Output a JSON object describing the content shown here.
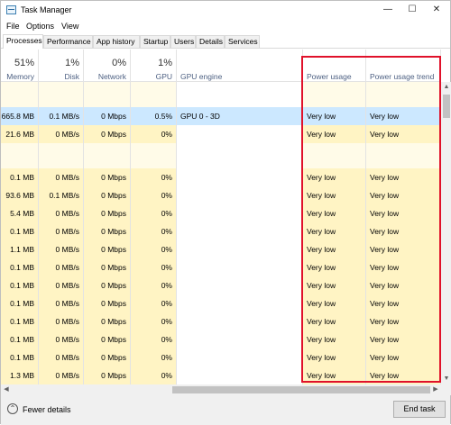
{
  "window": {
    "title": "Task Manager",
    "app_icon": "task-manager-icon"
  },
  "window_controls": {
    "minimize": "—",
    "maximize": "☐",
    "close": "✕"
  },
  "menu": [
    "File",
    "Options",
    "View"
  ],
  "tabs": [
    {
      "label": "Processes",
      "active": true
    },
    {
      "label": "Performance",
      "active": false
    },
    {
      "label": "App history",
      "active": false
    },
    {
      "label": "Startup",
      "active": false
    },
    {
      "label": "Users",
      "active": false
    },
    {
      "label": "Details",
      "active": false
    },
    {
      "label": "Services",
      "active": false
    }
  ],
  "columns": [
    {
      "label": "Memory",
      "percent": "51%"
    },
    {
      "label": "Disk",
      "percent": "1%"
    },
    {
      "label": "Network",
      "percent": "0%"
    },
    {
      "label": "GPU",
      "percent": "1%"
    },
    {
      "label": "GPU engine",
      "percent": ""
    },
    {
      "label": "Power usage",
      "percent": ""
    },
    {
      "label": "Power usage trend",
      "percent": ""
    }
  ],
  "rows": [
    {
      "memory": "",
      "disk": "",
      "network": "",
      "gpu": "",
      "gpu_engine": "",
      "power": "",
      "trend": "",
      "group": true
    },
    {
      "memory": "665.8 MB",
      "disk": "0.1 MB/s",
      "network": "0 Mbps",
      "gpu": "0.5%",
      "gpu_engine": "GPU 0 - 3D",
      "power": "Very low",
      "trend": "Very low",
      "selected": true
    },
    {
      "memory": "21.6 MB",
      "disk": "0 MB/s",
      "network": "0 Mbps",
      "gpu": "0%",
      "gpu_engine": "",
      "power": "Very low",
      "trend": "Very low"
    },
    {
      "memory": "",
      "disk": "",
      "network": "",
      "gpu": "",
      "gpu_engine": "",
      "power": "",
      "trend": "",
      "group": true
    },
    {
      "memory": "0.1 MB",
      "disk": "0 MB/s",
      "network": "0 Mbps",
      "gpu": "0%",
      "gpu_engine": "",
      "power": "Very low",
      "trend": "Very low"
    },
    {
      "memory": "93.6 MB",
      "disk": "0.1 MB/s",
      "network": "0 Mbps",
      "gpu": "0%",
      "gpu_engine": "",
      "power": "Very low",
      "trend": "Very low"
    },
    {
      "memory": "5.4 MB",
      "disk": "0 MB/s",
      "network": "0 Mbps",
      "gpu": "0%",
      "gpu_engine": "",
      "power": "Very low",
      "trend": "Very low"
    },
    {
      "memory": "0.1 MB",
      "disk": "0 MB/s",
      "network": "0 Mbps",
      "gpu": "0%",
      "gpu_engine": "",
      "power": "Very low",
      "trend": "Very low"
    },
    {
      "memory": "1.1 MB",
      "disk": "0 MB/s",
      "network": "0 Mbps",
      "gpu": "0%",
      "gpu_engine": "",
      "power": "Very low",
      "trend": "Very low"
    },
    {
      "memory": "0.1 MB",
      "disk": "0 MB/s",
      "network": "0 Mbps",
      "gpu": "0%",
      "gpu_engine": "",
      "power": "Very low",
      "trend": "Very low"
    },
    {
      "memory": "0.1 MB",
      "disk": "0 MB/s",
      "network": "0 Mbps",
      "gpu": "0%",
      "gpu_engine": "",
      "power": "Very low",
      "trend": "Very low"
    },
    {
      "memory": "0.1 MB",
      "disk": "0 MB/s",
      "network": "0 Mbps",
      "gpu": "0%",
      "gpu_engine": "",
      "power": "Very low",
      "trend": "Very low"
    },
    {
      "memory": "0.1 MB",
      "disk": "0 MB/s",
      "network": "0 Mbps",
      "gpu": "0%",
      "gpu_engine": "",
      "power": "Very low",
      "trend": "Very low"
    },
    {
      "memory": "0.1 MB",
      "disk": "0 MB/s",
      "network": "0 Mbps",
      "gpu": "0%",
      "gpu_engine": "",
      "power": "Very low",
      "trend": "Very low"
    },
    {
      "memory": "0.1 MB",
      "disk": "0 MB/s",
      "network": "0 Mbps",
      "gpu": "0%",
      "gpu_engine": "",
      "power": "Very low",
      "trend": "Very low"
    },
    {
      "memory": "1.3 MB",
      "disk": "0 MB/s",
      "network": "0 Mbps",
      "gpu": "0%",
      "gpu_engine": "",
      "power": "Very low",
      "trend": "Very low"
    }
  ],
  "footer": {
    "fewer_details": "Fewer details",
    "end_task": "End task"
  },
  "colors": {
    "heat_light": "#fff4c4",
    "heat_group": "#fffbe8",
    "selected_row": "#cce8ff",
    "highlight_border": "#e0112a",
    "header_label": "#4d6082"
  }
}
